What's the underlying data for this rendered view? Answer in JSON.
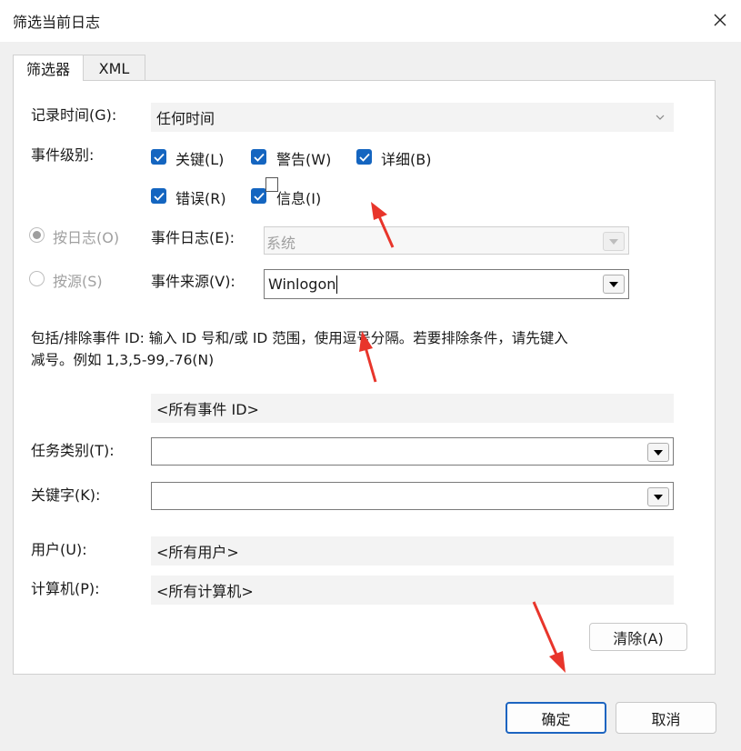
{
  "window": {
    "title": "筛选当前日志"
  },
  "tabs": [
    {
      "label": "筛选器"
    },
    {
      "label": "XML"
    }
  ],
  "logged": {
    "label": "记录时间(G):",
    "value": "任何时间"
  },
  "levels": {
    "label": "事件级别:",
    "items": [
      {
        "label": "关键(L)",
        "checked": true
      },
      {
        "label": "警告(W)",
        "checked": true
      },
      {
        "label": "详细(B)",
        "checked": true
      },
      {
        "label": "错误(R)",
        "checked": true
      },
      {
        "label": "信息(I)",
        "checked": true
      }
    ]
  },
  "by_log": {
    "radio_label": "按日志(O)",
    "field_label": "事件日志(E):",
    "value": "系统"
  },
  "by_source": {
    "radio_label": "按源(S)",
    "field_label": "事件来源(V):",
    "value": "Winlogon"
  },
  "event_ids": {
    "description_line1": "包括/排除事件 ID: 输入 ID 号和/或 ID 范围，使用逗号分隔。若要排除条件，请先键入",
    "description_line2": "减号。例如 1,3,5-99,-76(N)",
    "value": "<所有事件 ID>"
  },
  "task_category": {
    "label": "任务类别(T):",
    "value": ""
  },
  "keywords": {
    "label": "关键字(K):",
    "value": ""
  },
  "user": {
    "label": "用户(U):",
    "value": "<所有用户>"
  },
  "computer": {
    "label": "计算机(P):",
    "value": "<所有计算机>"
  },
  "buttons": {
    "clear": "清除(A)",
    "ok": "确定",
    "cancel": "取消"
  },
  "colors": {
    "accent": "#1465c0",
    "annotation_arrow": "#e8352b"
  }
}
